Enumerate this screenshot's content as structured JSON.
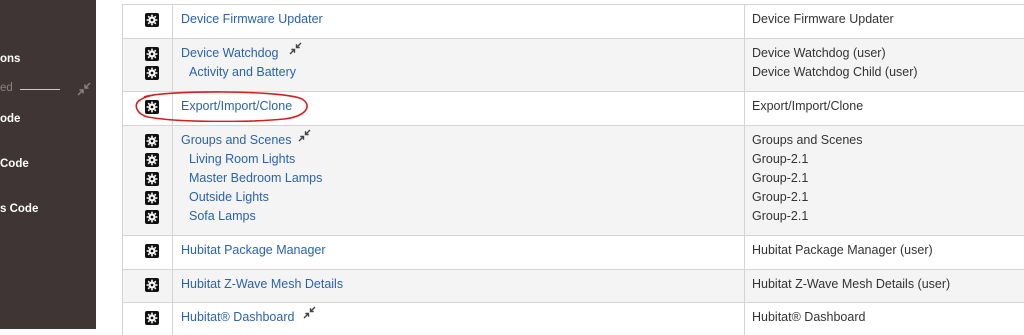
{
  "sidebar": {
    "items": [
      {
        "label": "ons"
      },
      {
        "label": "ed"
      },
      {
        "label": "ode"
      },
      {
        "label": "Code"
      },
      {
        "label": "s Code"
      }
    ]
  },
  "apps": [
    {
      "parent": {
        "name": "Device Firmware Updater",
        "type": "Device Firmware Updater"
      },
      "children": [],
      "collapsible": false
    },
    {
      "parent": {
        "name": "Device Watchdog",
        "type": "Device Watchdog (user)"
      },
      "children": [
        {
          "name": "Activity and Battery",
          "type": "Device Watchdog Child (user)"
        }
      ],
      "collapsible": true
    },
    {
      "parent": {
        "name": "Export/Import/Clone",
        "type": "Export/Import/Clone"
      },
      "children": [],
      "collapsible": false,
      "circled": true
    },
    {
      "parent": {
        "name": "Groups and Scenes",
        "type": "Groups and Scenes"
      },
      "children": [
        {
          "name": "Living Room Lights",
          "type": "Group-2.1"
        },
        {
          "name": "Master Bedroom Lamps",
          "type": "Group-2.1"
        },
        {
          "name": "Outside Lights",
          "type": "Group-2.1"
        },
        {
          "name": "Sofa Lamps",
          "type": "Group-2.1"
        }
      ],
      "collapsible": true
    },
    {
      "parent": {
        "name": "Hubitat Package Manager",
        "type": "Hubitat Package Manager (user)"
      },
      "children": [],
      "collapsible": false
    },
    {
      "parent": {
        "name": "Hubitat Z-Wave Mesh Details",
        "type": "Hubitat Z-Wave Mesh Details (user)"
      },
      "children": [],
      "collapsible": false
    },
    {
      "parent": {
        "name": "Hubitat® Dashboard",
        "type": "Hubitat® Dashboard"
      },
      "children": [],
      "collapsible": true
    }
  ],
  "icons": {
    "settings": "gear-icon",
    "collapse": "collapse-arrows-icon"
  },
  "colors": {
    "sidebar": "#3f3534",
    "link": "#2a62ae",
    "annotation": "#d42020",
    "row_alt": "#f4f4f4"
  }
}
